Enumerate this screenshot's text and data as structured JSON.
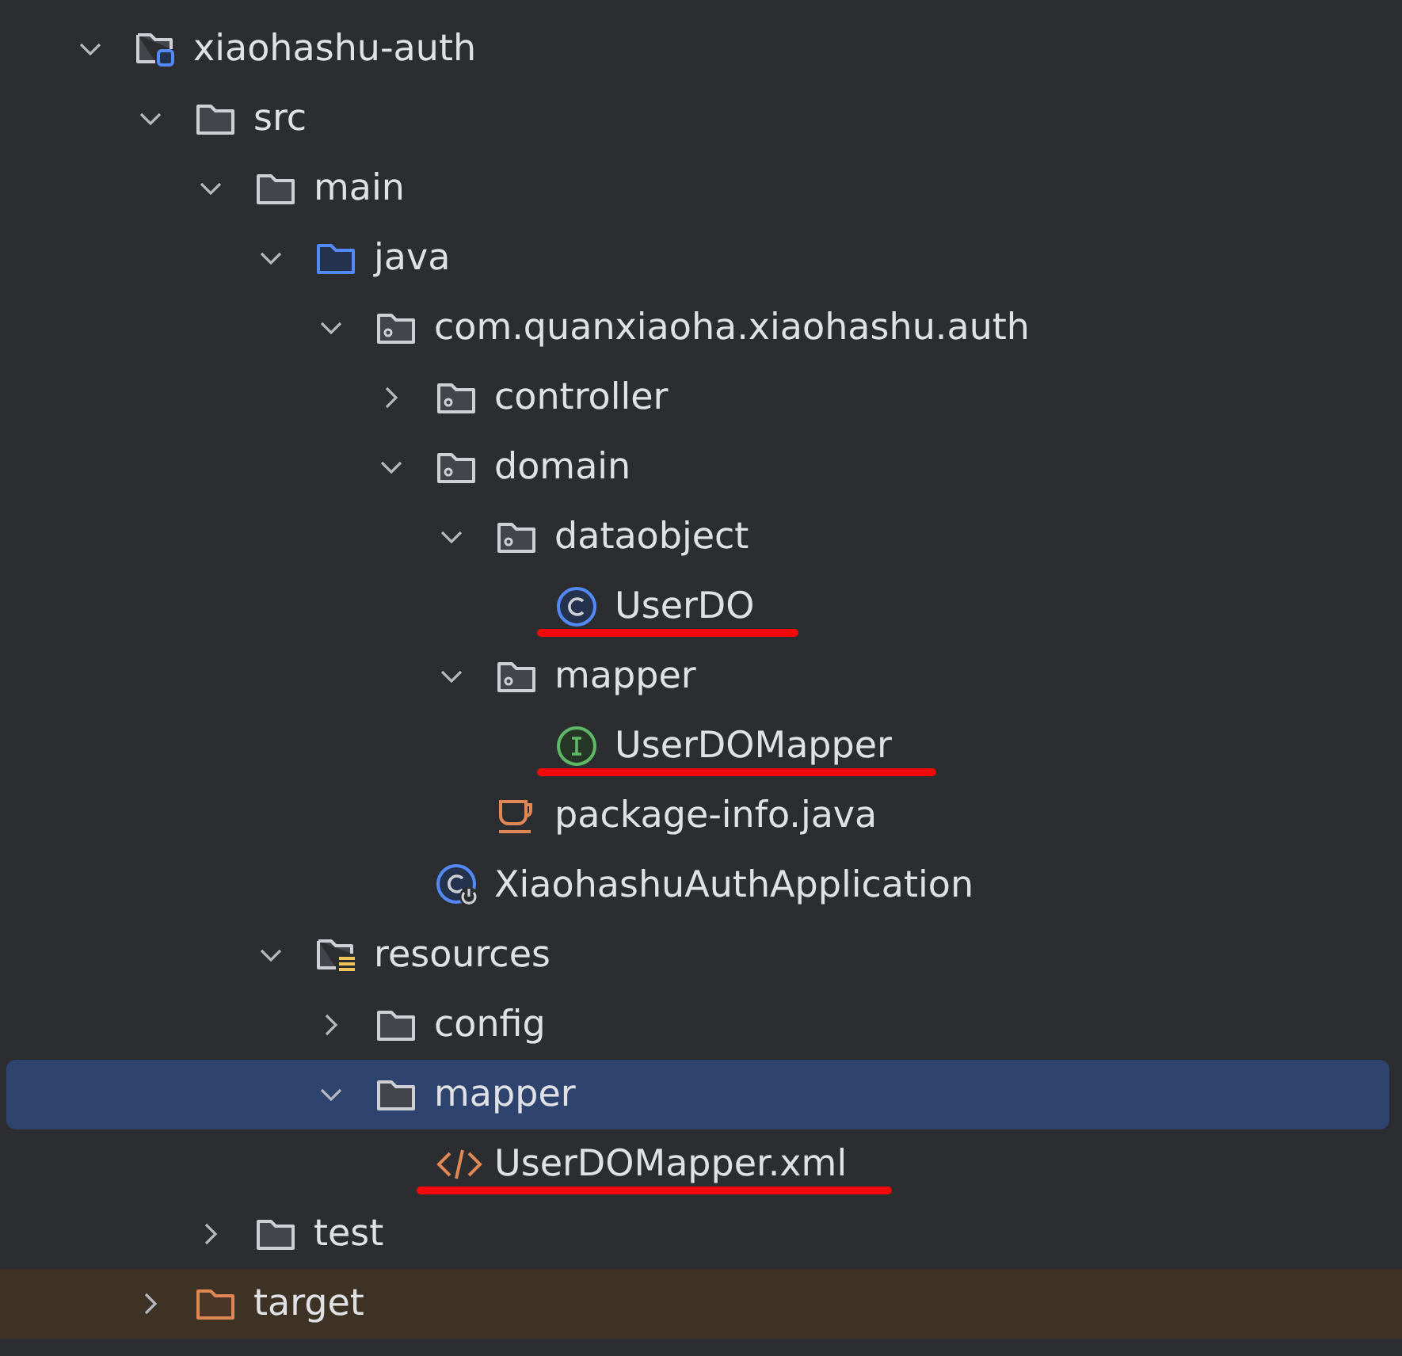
{
  "project_tree": [
    {
      "name": "xiaohashu-auth",
      "kind": "module",
      "expanded": true,
      "selected": false,
      "children": [
        {
          "name": "src",
          "kind": "folder",
          "expanded": true,
          "selected": false,
          "children": [
            {
              "name": "main",
              "kind": "folder",
              "expanded": true,
              "selected": false,
              "children": [
                {
                  "name": "java",
                  "kind": "source-folder",
                  "expanded": true,
                  "selected": false,
                  "children": [
                    {
                      "name": "com.quanxiaoha.xiaohashu.auth",
                      "kind": "package",
                      "expanded": true,
                      "selected": false,
                      "children": [
                        {
                          "name": "controller",
                          "kind": "package",
                          "expanded": false,
                          "selected": false
                        },
                        {
                          "name": "domain",
                          "kind": "package",
                          "expanded": true,
                          "selected": false,
                          "children": [
                            {
                              "name": "dataobject",
                              "kind": "package",
                              "expanded": true,
                              "selected": false,
                              "children": [
                                {
                                  "name": "UserDO",
                                  "kind": "class",
                                  "selected": false,
                                  "underlined": true
                                }
                              ]
                            },
                            {
                              "name": "mapper",
                              "kind": "package",
                              "expanded": true,
                              "selected": false,
                              "children": [
                                {
                                  "name": "UserDOMapper",
                                  "kind": "interface",
                                  "selected": false,
                                  "underlined": true
                                }
                              ]
                            },
                            {
                              "name": "package-info.java",
                              "kind": "java-file",
                              "selected": false
                            }
                          ]
                        },
                        {
                          "name": "XiaohashuAuthApplication",
                          "kind": "spring-app",
                          "selected": false
                        }
                      ]
                    }
                  ]
                },
                {
                  "name": "resources",
                  "kind": "resources-folder",
                  "expanded": true,
                  "selected": false,
                  "children": [
                    {
                      "name": "config",
                      "kind": "folder",
                      "expanded": false,
                      "selected": false
                    },
                    {
                      "name": "mapper",
                      "kind": "folder",
                      "expanded": true,
                      "selected": true,
                      "children": [
                        {
                          "name": "UserDOMapper.xml",
                          "kind": "xml-file",
                          "selected": false,
                          "underlined": true
                        }
                      ]
                    }
                  ]
                }
              ]
            },
            {
              "name": "test",
              "kind": "folder",
              "expanded": false,
              "selected": false
            }
          ]
        },
        {
          "name": "target",
          "kind": "excluded-folder",
          "expanded": false,
          "selected": false,
          "excluded": true
        }
      ]
    }
  ]
}
